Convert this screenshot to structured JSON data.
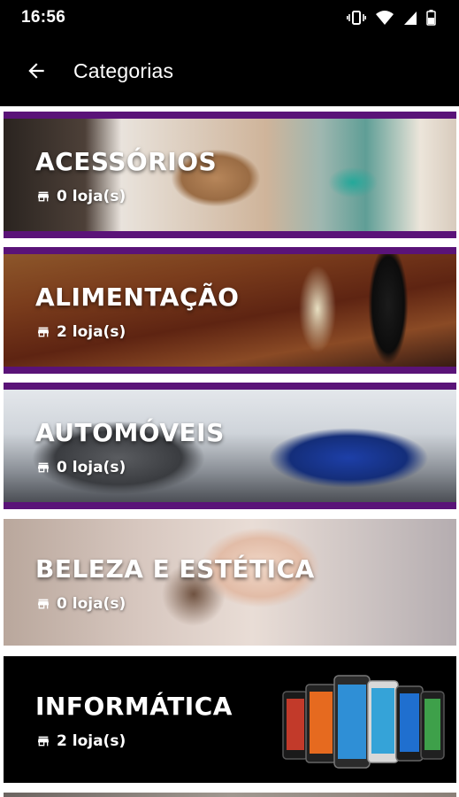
{
  "status_bar": {
    "time": "16:56",
    "icons": [
      "vibrate-icon",
      "wifi-icon",
      "signal-icon",
      "battery-icon"
    ]
  },
  "app_bar": {
    "back_icon": "arrow-back-icon",
    "title": "Categorias"
  },
  "categories": [
    {
      "name": "ACESSÓRIOS",
      "count": "0 loja(s)"
    },
    {
      "name": "ALIMENTAÇÃO",
      "count": "2 loja(s)"
    },
    {
      "name": "AUTOMÓVEIS",
      "count": "0 loja(s)"
    },
    {
      "name": "BELEZA E ESTÉTICA",
      "count": "0 loja(s)"
    },
    {
      "name": "INFORMÁTICA",
      "count": "2 loja(s)"
    }
  ],
  "colors": {
    "app_bar": "#000000",
    "accent_band": "#5a1378",
    "list_background": "#ffffff"
  }
}
